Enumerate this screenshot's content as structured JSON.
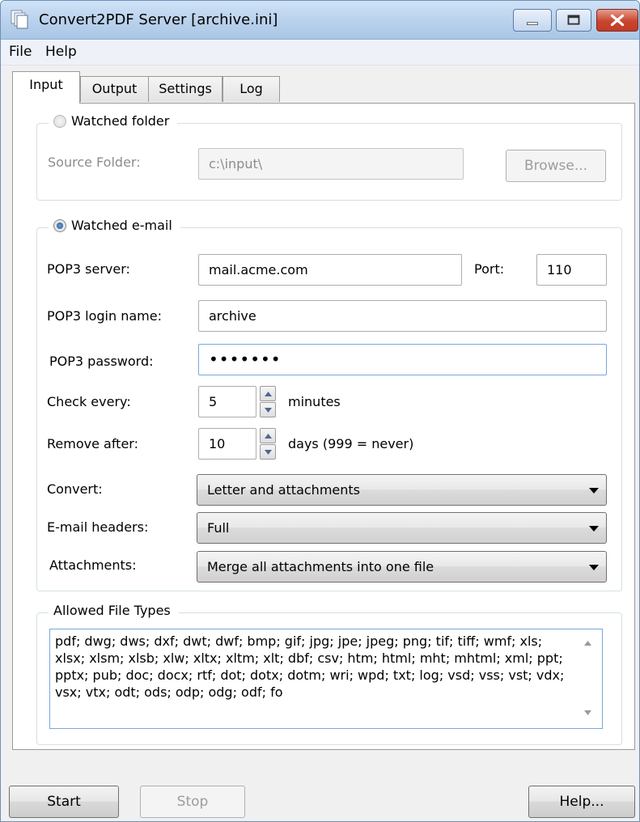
{
  "window": {
    "title": "Convert2PDF Server [archive.ini]",
    "icon": "document-stack-icon"
  },
  "menu": [
    "File",
    "Help"
  ],
  "tabs": [
    "Input",
    "Output",
    "Settings",
    "Log"
  ],
  "watched_folder": {
    "legend": "Watched folder",
    "selected": false,
    "source_label": "Source Folder:",
    "source_value": "c:\\input\\",
    "browse": "Browse..."
  },
  "watched_email": {
    "legend": "Watched e-mail",
    "selected": true,
    "pop3_server_label": "POP3 server:",
    "pop3_server_value": "mail.acme.com",
    "port_label": "Port:",
    "port_value": "110",
    "login_label": "POP3 login name:",
    "login_value": "archive",
    "password_label": "POP3 password:",
    "password_value": "•••••••",
    "check_label": "Check every:",
    "check_value": "5",
    "check_unit": "minutes",
    "remove_label": "Remove after:",
    "remove_value": "10",
    "remove_unit": "days (999 = never)",
    "convert_label": "Convert:",
    "convert_value": "Letter and attachments",
    "headers_label": "E-mail headers:",
    "headers_value": "Full",
    "attachments_label": "Attachments:",
    "attachments_value": "Merge all attachments into one file"
  },
  "allowed": {
    "legend": "Allowed File Types",
    "value": "pdf; dwg; dws; dxf; dwt; dwf; bmp; gif; jpg; jpe; jpeg; png; tif; tiff; wmf; xls; xlsx; xlsm; xlsb; xlw; xltx; xltm; xlt; dbf; csv; htm; html; mht; mhtml; xml; ppt; pptx; pub; doc; docx; rtf; dot; dotx; dotm; wri; wpd; txt; log; vsd; vss; vst; vdx; vsx; vtx; odt; ods; odp; odg; odf; fo"
  },
  "footer": {
    "start": "Start",
    "stop": "Stop",
    "help": "Help..."
  },
  "colors": {
    "titlebar": "#b9d1ec",
    "close_button": "#c8452f",
    "focus_border": "#7aa7d8"
  }
}
